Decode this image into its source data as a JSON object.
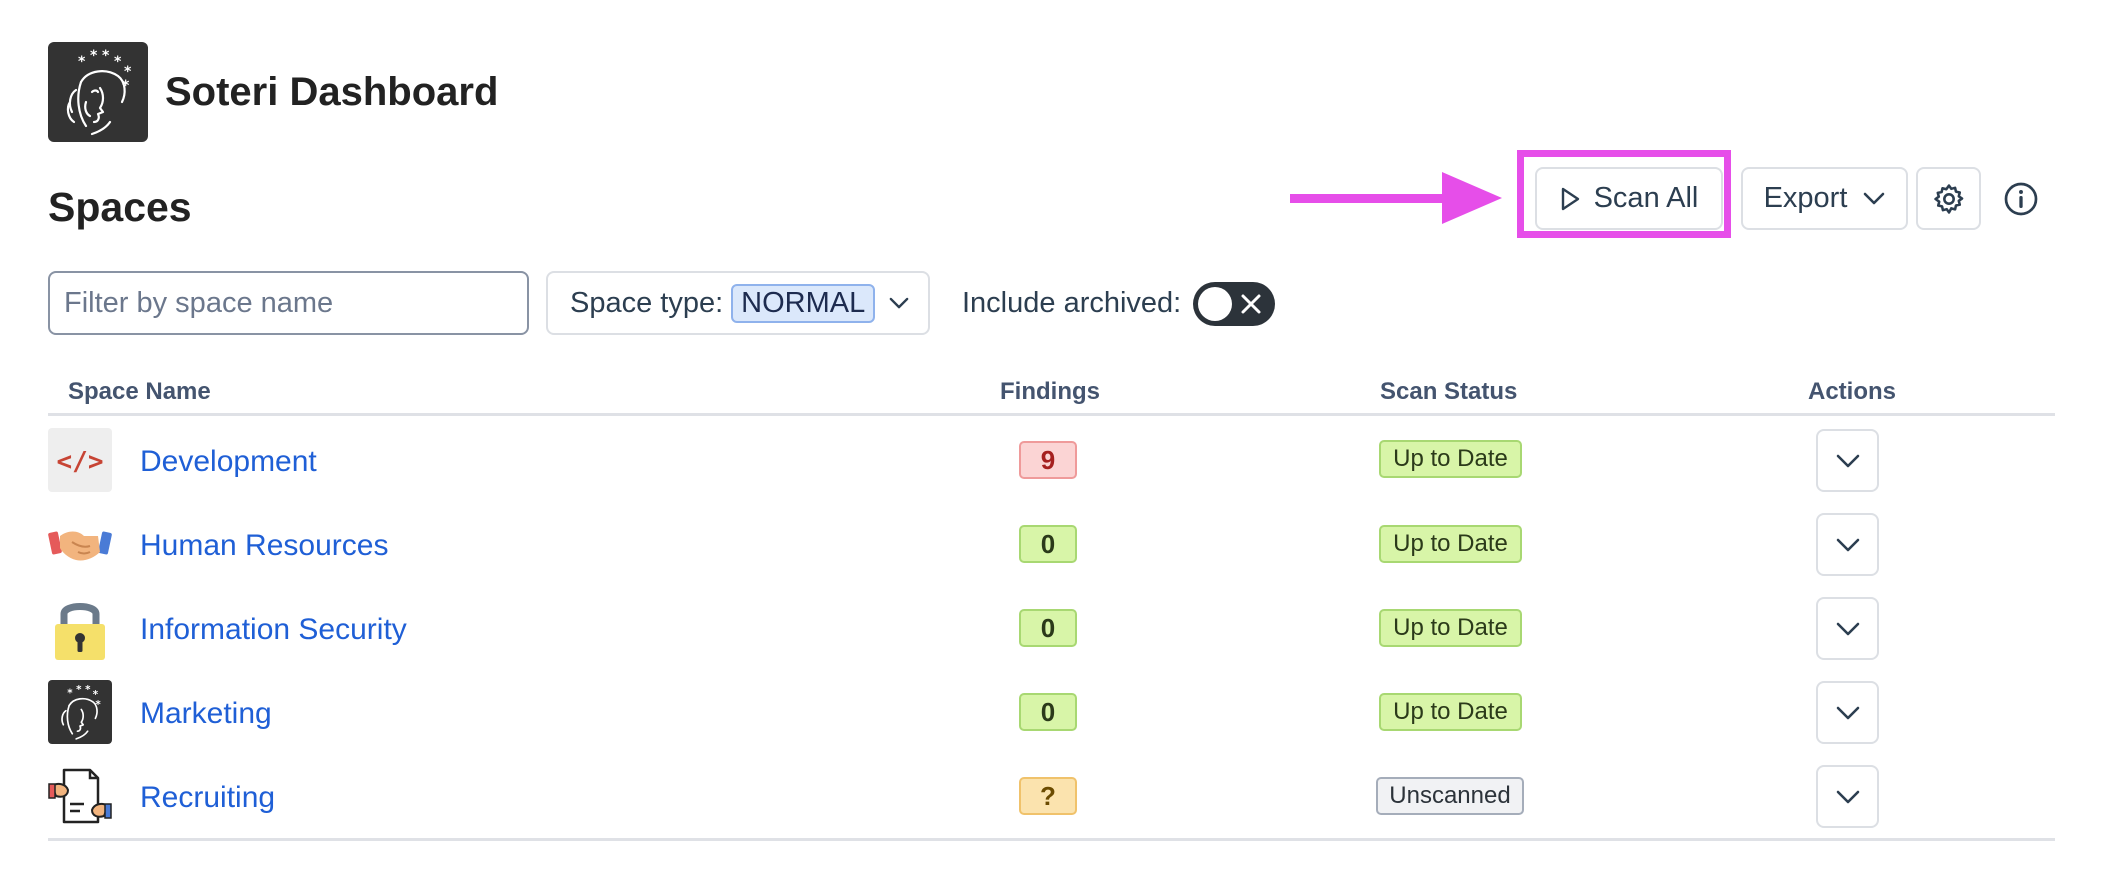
{
  "header": {
    "title": "Soteri Dashboard"
  },
  "section": {
    "title": "Spaces"
  },
  "toolbar": {
    "scan_all_label": "Scan All",
    "export_label": "Export"
  },
  "filters": {
    "name_placeholder": "Filter by space name",
    "name_value": "",
    "type_label": "Space type:",
    "type_value": "NORMAL",
    "archived_label": "Include archived:",
    "archived_on": false
  },
  "table": {
    "columns": [
      "Space Name",
      "Findings",
      "Scan Status",
      "Actions"
    ],
    "rows": [
      {
        "name": "Development",
        "icon": "code-icon",
        "findings": "9",
        "status": "Up to Date"
      },
      {
        "name": "Human Resources",
        "icon": "handshake-icon",
        "findings": "0",
        "status": "Up to Date"
      },
      {
        "name": "Information Security",
        "icon": "padlock-icon",
        "findings": "0",
        "status": "Up to Date"
      },
      {
        "name": "Marketing",
        "icon": "soteri-logo-icon",
        "findings": "0",
        "status": "Up to Date"
      },
      {
        "name": "Recruiting",
        "icon": "resume-icon",
        "findings": "?",
        "status": "Unscanned"
      }
    ]
  },
  "colors": {
    "link": "#1f5fd6",
    "highlight": "#e64ee9",
    "findings_danger": "#fbd4d4",
    "findings_ok": "#d8f5a8",
    "findings_unknown": "#fbe3ae"
  }
}
